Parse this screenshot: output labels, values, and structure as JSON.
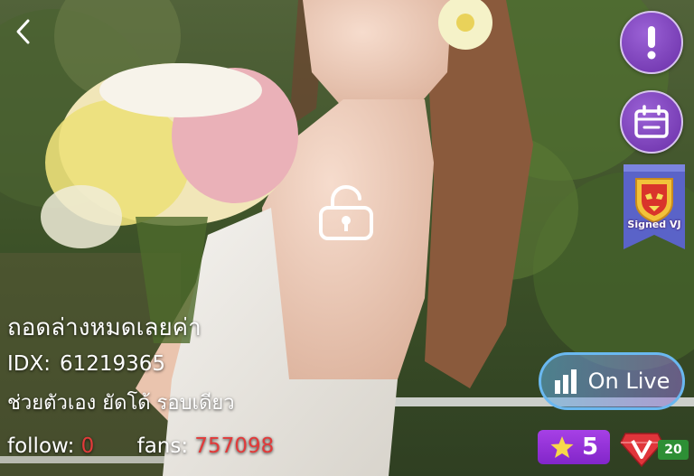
{
  "stream": {
    "title": "ถอดล่างหมดเลยค่า",
    "idx_label": "IDX:",
    "idx_value": "61219365",
    "tagline": "ช่วยตัวเอง ยัดโด้ รอบเดียว",
    "follow_label": "follow:",
    "follow_value": "0",
    "fans_label": "fans:",
    "fans_value": "757098"
  },
  "badges": {
    "signed_label": "Signed VJ",
    "level_value": "5",
    "vip_level": "20"
  },
  "live_button": {
    "label": "On Live"
  },
  "icons": {
    "back": "chevron-left-icon",
    "lock": "unlocked-padlock-icon",
    "report": "exclamation-icon",
    "schedule": "calendar-icon",
    "signed": "shield-badge-icon",
    "live": "signal-bars-icon",
    "level": "star-icon",
    "vip": "diamond-v-icon"
  },
  "colors": {
    "accent_purple": "#8a3fd1",
    "live_border": "#6ab8f0",
    "stat_value_red": "#e23a3a",
    "vip_green": "#2d8f35"
  }
}
